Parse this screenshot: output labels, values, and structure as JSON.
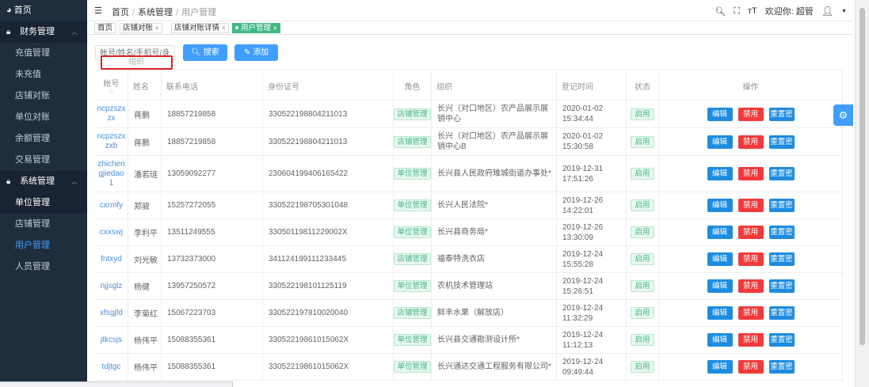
{
  "sidebar": {
    "home": {
      "icon": "dashboard-icon",
      "label": "首页"
    },
    "groups": [
      {
        "icon": "lock-icon",
        "label": "财务管理",
        "items": [
          "充值管理",
          "未充值",
          "店铺对账",
          "单位对账",
          "余额管理",
          "交易管理"
        ]
      },
      {
        "icon": "lock-icon",
        "label": "系统管理",
        "items": [
          "单位管理",
          "店铺管理",
          "用户管理",
          "人员管理"
        ]
      }
    ]
  },
  "header": {
    "breadcrumb": [
      "首页",
      "系统管理",
      "用户管理"
    ],
    "welcome": "欢迎你: 超管"
  },
  "tags": [
    "首页",
    "店铺对账",
    "店铺对账详情",
    "用户管理"
  ],
  "toolbar": {
    "search_placeholder": "帐号/姓名/手机号/身",
    "org_placeholder": "组织",
    "search_label": "搜索",
    "add_label": "添加"
  },
  "table": {
    "headers": [
      "帐号",
      "姓名",
      "联系电话",
      "身份证号",
      "角色",
      "组织",
      "登记时间",
      "状态",
      "操作"
    ],
    "ops": [
      "编辑",
      "禁用",
      "重置密"
    ],
    "rows": [
      {
        "account": "ncpzszxzx",
        "name": "蒋鹏",
        "phone": "18857219858",
        "id_no": "330522198804211013",
        "role": "店铺管理",
        "org": "长兴（对口地区）农产品展示展销中心",
        "time": "2020-01-02 15:34:44",
        "status": "启用"
      },
      {
        "account": "ncpzszxzxb",
        "name": "蒋鹏",
        "phone": "18857219858",
        "id_no": "330522198804211013",
        "role": "店铺管理",
        "org": "长兴（对口地区）农产品展示展销中心B",
        "time": "2020-01-02 15:30:58",
        "status": "启用"
      },
      {
        "account": "zhichengjiedao1",
        "name": "潘若琏",
        "phone": "13059092277",
        "id_no": "230604199406165422",
        "role": "单位管理",
        "org": "长兴县人民政府雉城街道办事处*",
        "time": "2019-12-31 17:51:26",
        "status": "启用"
      },
      {
        "account": "cxrmfy",
        "name": "郑骏",
        "phone": "15257272055",
        "id_no": "330522198705301048",
        "role": "单位管理",
        "org": "长兴人民法院*",
        "time": "2019-12-26 14:22:01",
        "status": "启用"
      },
      {
        "account": "cxxswj",
        "name": "李利平",
        "phone": "13511249555",
        "id_no": "33050119811229002X",
        "role": "单位管理",
        "org": "长兴县商务局*",
        "time": "2019-12-26 13:30:09",
        "status": "启用"
      },
      {
        "account": "fntxyd",
        "name": "刘光敏",
        "phone": "13732373000",
        "id_no": "341124199111233445",
        "role": "店铺管理",
        "org": "福泰特洗衣店",
        "time": "2019-12-24 15:55:28",
        "status": "启用"
      },
      {
        "account": "njjsglz",
        "name": "杨健",
        "phone": "13957250572",
        "id_no": "330522198101125119",
        "role": "单位管理",
        "org": "农机技术管理站",
        "time": "2019-12-24 15:26:51",
        "status": "启用"
      },
      {
        "account": "xfsgjfd",
        "name": "李菊红",
        "phone": "15067223703",
        "id_no": "330522197810020040",
        "role": "店铺管理",
        "org": "鲜丰水果（解放店）",
        "time": "2019-12-24 11:32:29",
        "status": "启用"
      },
      {
        "account": "jtkcsjs",
        "name": "杨伟平",
        "phone": "15088355361",
        "id_no": "33052219861015062X",
        "role": "单位管理",
        "org": "长兴县交通勘测设计所*",
        "time": "2019-12-24 11:12:13",
        "status": "启用"
      },
      {
        "account": "tdjtgc",
        "name": "杨伟平",
        "phone": "15088355361",
        "id_no": "33052219861015062X",
        "role": "单位管理",
        "org": "长兴通达交通工程服务有限公司*",
        "time": "2019-12-24 09:49:44",
        "status": "启用"
      }
    ]
  }
}
